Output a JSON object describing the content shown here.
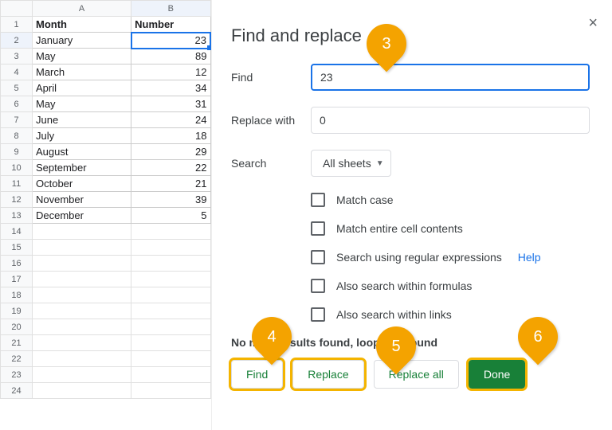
{
  "grid": {
    "col_headers": [
      "",
      "A",
      "B"
    ],
    "header_row": {
      "month": "Month",
      "number": "Number"
    },
    "rows": [
      {
        "n": 1,
        "month": "Month",
        "number": "Number",
        "isHeader": true
      },
      {
        "n": 2,
        "month": "January",
        "number": "23",
        "selected": true
      },
      {
        "n": 3,
        "month": "May",
        "number": "89"
      },
      {
        "n": 4,
        "month": "March",
        "number": "12"
      },
      {
        "n": 5,
        "month": "April",
        "number": "34"
      },
      {
        "n": 6,
        "month": "May",
        "number": "31"
      },
      {
        "n": 7,
        "month": "June",
        "number": "24"
      },
      {
        "n": 8,
        "month": "July",
        "number": "18"
      },
      {
        "n": 9,
        "month": "August",
        "number": "29"
      },
      {
        "n": 10,
        "month": "September",
        "number": "22"
      },
      {
        "n": 11,
        "month": "October",
        "number": "21"
      },
      {
        "n": 12,
        "month": "November",
        "number": "39"
      },
      {
        "n": 13,
        "month": "December",
        "number": "5"
      }
    ],
    "empty_rows": [
      14,
      15,
      16,
      17,
      18,
      19,
      20,
      21,
      22,
      23,
      24
    ]
  },
  "dialog": {
    "title": "Find and replace",
    "find_label": "Find",
    "find_value": "23",
    "replace_label": "Replace with",
    "replace_value": "0",
    "search_label": "Search",
    "search_scope": "All sheets",
    "checks": {
      "match_case": "Match case",
      "entire_cell": "Match entire cell contents",
      "regex": "Search using regular expressions",
      "help": "Help",
      "formulas": "Also search within formulas",
      "links": "Also search within links"
    },
    "status": "No more results found, looping around",
    "btn_find": "Find",
    "btn_replace": "Replace",
    "btn_replace_all": "Replace all",
    "btn_done": "Done"
  },
  "annotations": {
    "b3": "3",
    "b4": "4",
    "b5": "5",
    "b6": "6"
  }
}
